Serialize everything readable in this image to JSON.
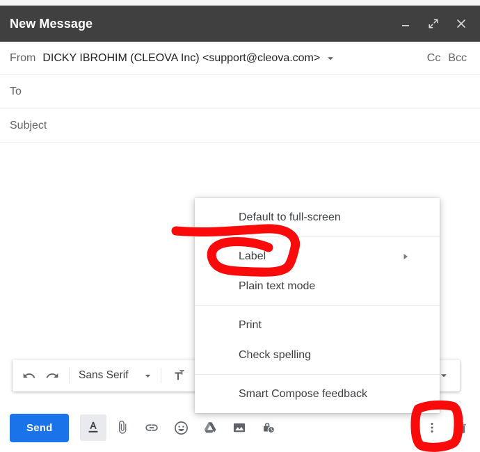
{
  "window": {
    "title": "New Message",
    "minimize_icon": "minimize-icon",
    "fullscreen_icon": "fullscreen-icon",
    "close_icon": "close-icon",
    "header_bg": "#404040"
  },
  "fields": {
    "from": {
      "label": "From",
      "value": "DICKY IBROHIM (CLEOVA Inc) <support@cleova.com>",
      "caret_icon": "chevron-down-icon"
    },
    "to": {
      "label": "To",
      "value": "",
      "placeholder": "To"
    },
    "subject": {
      "label": "Subject",
      "value": "",
      "placeholder": "Subject"
    },
    "cc": "Cc",
    "bcc": "Bcc"
  },
  "body": {
    "value": "",
    "placeholder": ""
  },
  "format_toolbar": {
    "undo_label": "Undo",
    "redo_label": "Redo",
    "font_family": "Sans Serif",
    "font_caret_icon": "chevron-down-icon",
    "font_size_icon": "font-size-icon",
    "more_formatting_icon": "chevron-down-icon"
  },
  "action_bar": {
    "send_label": "Send",
    "send_color": "#1a73e8",
    "formatting_icon": "format-text-icon",
    "attach_icon": "paperclip-icon",
    "link_icon": "link-icon",
    "emoji_icon": "emoji-icon",
    "drive_icon": "google-drive-icon",
    "photo_icon": "insert-photo-icon",
    "confidential_icon": "confidential-mode-icon",
    "more_options_icon": "more-options-icon",
    "discard_icon": "trash-icon"
  },
  "more_menu": {
    "items": [
      {
        "label": "Default to full-screen",
        "submenu": false
      },
      {
        "label": "Label",
        "submenu": true,
        "arrow_icon": "triangle-right-icon"
      },
      {
        "label": "Plain text mode",
        "submenu": false
      },
      {
        "label": "Print",
        "submenu": false
      },
      {
        "label": "Check spelling",
        "submenu": false
      },
      {
        "label": "Smart Compose feedback",
        "submenu": false
      }
    ]
  },
  "annotations": {
    "color": "#fa0a0a",
    "circle_label_target": "Label",
    "rect_target": "more-options-icon"
  }
}
